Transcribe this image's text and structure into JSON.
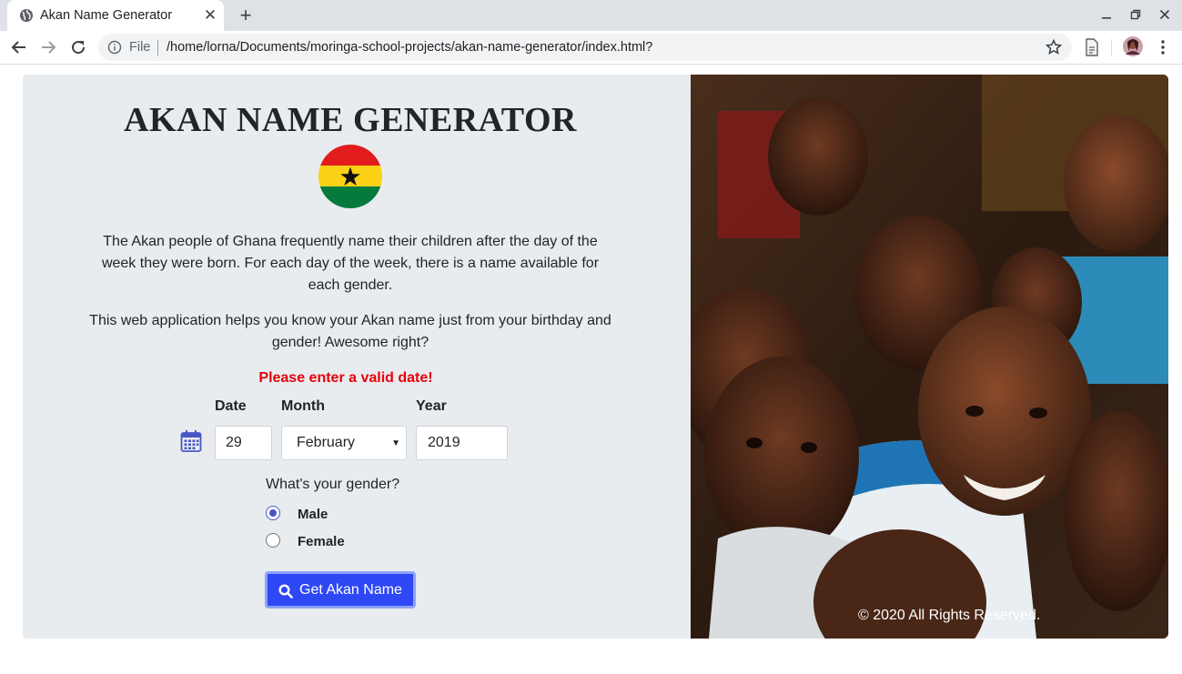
{
  "browser": {
    "tab_title": "Akan Name Generator",
    "new_tab_label": "+",
    "file_label": "File",
    "url": "/home/lorna/Documents/moringa-school-projects/akan-name-generator/index.html?"
  },
  "header": {
    "title": "AKAN NAME GENERATOR"
  },
  "intro": {
    "paragraph1": "The Akan people of Ghana frequently name their children after the day of the week they were born. For each day of the week, there is a name available for each gender.",
    "paragraph2": "This web application helps you know your Akan name just from your birthday and gender! Awesome right?"
  },
  "form": {
    "error_message": "Please enter a valid date!",
    "date_label": "Date",
    "month_label": "Month",
    "year_label": "Year",
    "date_value": "29",
    "month_value": "February",
    "year_value": "2019",
    "gender_question": "What's your gender?",
    "gender_options": [
      {
        "label": "Male",
        "checked": true
      },
      {
        "label": "Female",
        "checked": false
      }
    ],
    "submit_label": "Get Akan Name"
  },
  "footer": {
    "copyright": "© 2020 All Rights Reserved."
  },
  "colors": {
    "panel_bg": "#e9ecef",
    "error": "#e8000b",
    "button": "#2f48f5",
    "radio_accent": "#4a55c7",
    "flag_red": "#e21c1c",
    "flag_yellow": "#fcd116",
    "flag_green": "#057a3c"
  },
  "icons": {
    "favicon": "globe-icon",
    "back": "arrow-left-icon",
    "forward": "arrow-right-icon",
    "reload": "reload-icon",
    "info": "info-icon",
    "bookmark": "star-icon",
    "reader": "page-icon",
    "profile": "avatar",
    "menu": "kebab-menu-icon",
    "calendar": "calendar-icon",
    "search": "search-icon"
  }
}
